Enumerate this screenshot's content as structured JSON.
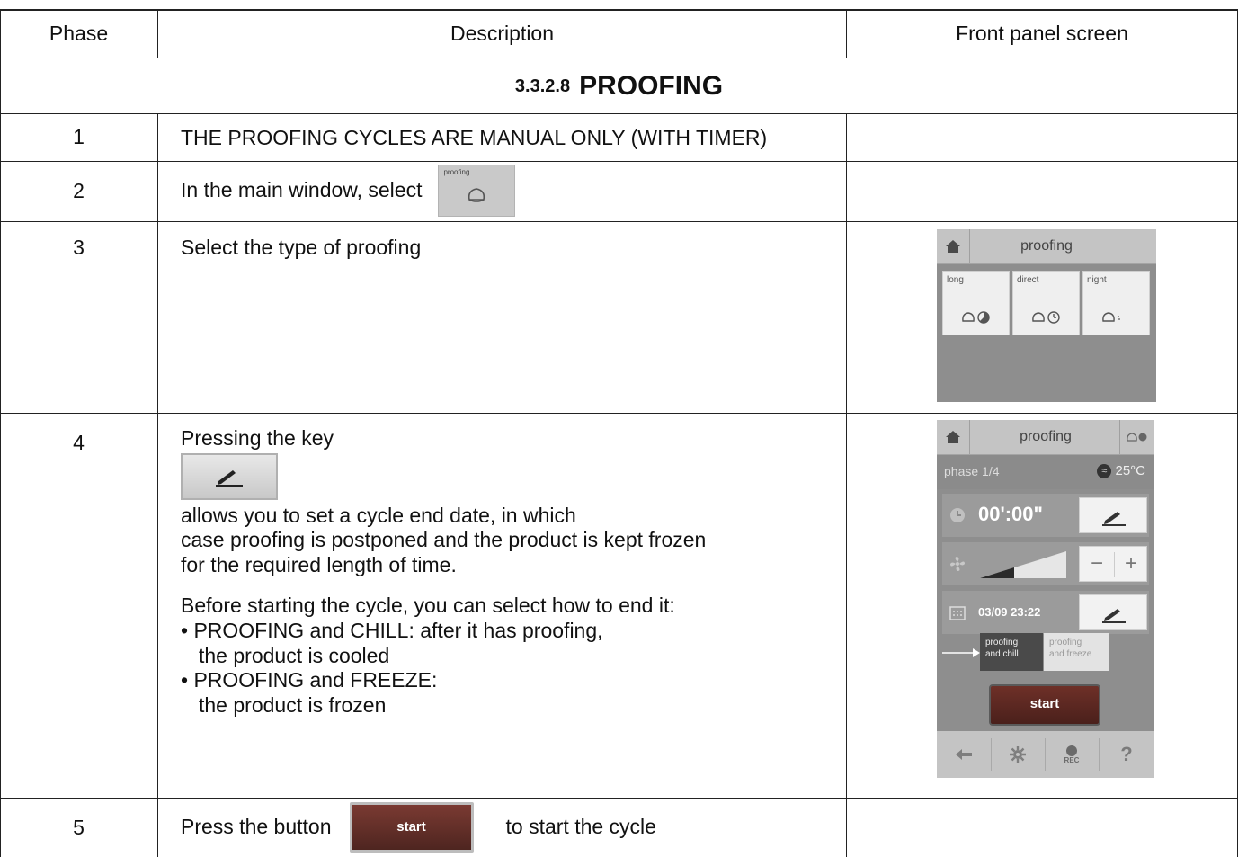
{
  "headers": {
    "phase": "Phase",
    "description": "Description",
    "panel": "Front panel screen"
  },
  "section": {
    "number": "3.3.2.8",
    "title": "PROOFING"
  },
  "rows": [
    {
      "phase": "1",
      "text": "THE PROOFING CYCLES ARE MANUAL ONLY (WITH TIMER)"
    },
    {
      "phase": "2",
      "text": "In the main window, select",
      "icon_label": "proofing"
    },
    {
      "phase": "3",
      "text": "Select the type of proofing"
    },
    {
      "phase": "4",
      "text_a": "Pressing the key",
      "text_b": "allows you to set a cycle end date, in which",
      "text_c": "case proofing is postponed and the product is kept frozen",
      "text_d": "for the required length of time.",
      "text_e": "Before starting the cycle, you can select how to end it:",
      "bullet1_a": "• PROOFING and CHILL: after it has proofing,",
      "bullet1_b": "the product is cooled",
      "bullet2_a": "• PROOFING and FREEZE:",
      "bullet2_b": "the product is frozen"
    },
    {
      "phase": "5",
      "text_a": "Press the button",
      "button": "start",
      "text_b": "to start the cycle"
    }
  ],
  "panel3": {
    "title": "proofing",
    "tiles": [
      "long",
      "direct",
      "night"
    ]
  },
  "panel4": {
    "title": "proofing",
    "phase": "phase 1/4",
    "temp": "25°C",
    "time": "00':00\"",
    "minus": "−",
    "plus": "+",
    "date": "03/09 23:22",
    "opt1_a": "proofing",
    "opt1_b": "and chill",
    "opt2_a": "proofing",
    "opt2_b": "and freeze",
    "start": "start",
    "rec": "REC",
    "help": "?"
  },
  "colors": {
    "start_button": "#5a2a24",
    "panel_bg": "#8e8e8e"
  }
}
